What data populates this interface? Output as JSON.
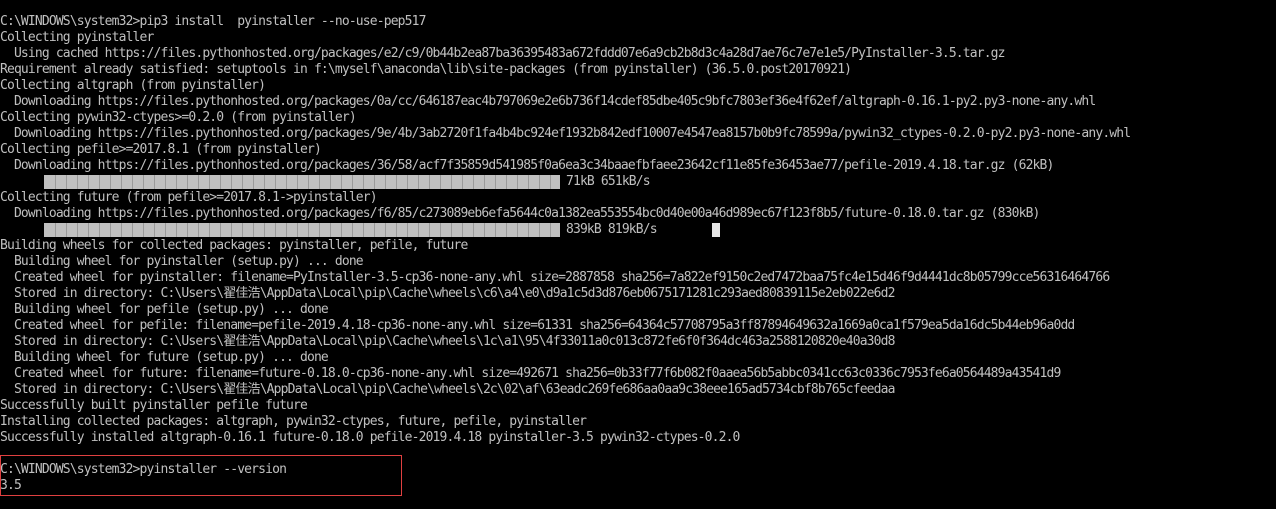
{
  "terminal": {
    "lines": [
      "C:\\WINDOWS\\system32>pip3 install  pyinstaller --no-use-pep517",
      "Collecting pyinstaller",
      "  Using cached https://files.pythonhosted.org/packages/e2/c9/0b44b2ea87ba36395483a672fddd07e6a9cb2b8d3c4a28d7ae76c7e7e1e5/PyInstaller-3.5.tar.gz",
      "Requirement already satisfied: setuptools in f:\\myself\\anaconda\\lib\\site-packages (from pyinstaller) (36.5.0.post20170921)",
      "Collecting altgraph (from pyinstaller)",
      "  Downloading https://files.pythonhosted.org/packages/0a/cc/646187eac4b797069e2e6b736f14cdef85dbe405c9bfc7803ef36e4f62ef/altgraph-0.16.1-py2.py3-none-any.whl",
      "Collecting pywin32-ctypes>=0.2.0 (from pyinstaller)",
      "  Downloading https://files.pythonhosted.org/packages/9e/4b/3ab2720f1fa4b4bc924ef1932b842edf10007e4547ea8157b0b9fc78599a/pywin32_ctypes-0.2.0-py2.py3-none-any.whl",
      "Collecting pefile>=2017.8.1 (from pyinstaller)",
      "  Downloading https://files.pythonhosted.org/packages/36/58/acf7f35859d541985f0a6ea3c34baaefbfaee23642cf11e85fe36453ae77/pefile-2019.4.18.tar.gz (62kB)",
      null,
      "Collecting future (from pefile>=2017.8.1->pyinstaller)",
      "  Downloading https://files.pythonhosted.org/packages/f6/85/c273089eb6efa5644c0a1382ea553554bc0d40e00a46d989ec67f123f8b5/future-0.18.0.tar.gz (830kB)",
      null,
      "Building wheels for collected packages: pyinstaller, pefile, future",
      "  Building wheel for pyinstaller (setup.py) ... done",
      "  Created wheel for pyinstaller: filename=PyInstaller-3.5-cp36-none-any.whl size=2887858 sha256=7a822ef9150c2ed7472baa75fc4e15d46f9d4441dc8b05799cce56316464766",
      "  Stored in directory: C:\\Users\\翟佳浩\\AppData\\Local\\pip\\Cache\\wheels\\c6\\a4\\e0\\d9a1c5d3d876eb0675171281c293aed80839115e2eb022e6d2",
      "  Building wheel for pefile (setup.py) ... done",
      "  Created wheel for pefile: filename=pefile-2019.4.18-cp36-none-any.whl size=61331 sha256=64364c57708795a3ff87894649632a1669a0ca1f579ea5da16dc5b44eb96a0dd",
      "  Stored in directory: C:\\Users\\翟佳浩\\AppData\\Local\\pip\\Cache\\wheels\\1c\\a1\\95\\4f33011a0c013c872fe6f0f364dc463a2588120820e40a30d8",
      "  Building wheel for future (setup.py) ... done",
      "  Created wheel for future: filename=future-0.18.0-cp36-none-any.whl size=492671 sha256=0b33f77f6b082f0aaea56b5abbc0341cc63c0336c7953fe6a0564489a43541d9",
      "  Stored in directory: C:\\Users\\翟佳浩\\AppData\\Local\\pip\\Cache\\wheels\\2c\\02\\af\\63eadc269fe686aa0aa9c38eee165ad5734cbf8b765cfeedaa",
      "Successfully built pyinstaller pefile future",
      "Installing collected packages: altgraph, pywin32-ctypes, future, pefile, pyinstaller",
      "Successfully installed altgraph-0.16.1 future-0.18.0 pefile-2019.4.18 pyinstaller-3.5 pywin32-ctypes-0.2.0",
      "",
      "C:\\WINDOWS\\system32>pyinstaller --version",
      "3.5"
    ],
    "progress": [
      {
        "stats": "71kB 651kB/s",
        "fraction": 1.0
      },
      {
        "stats": "839kB 819kB/s",
        "fraction": 1.0
      }
    ],
    "colors": {
      "background": "#000000",
      "foreground": "#c0c0c0",
      "highlight_border": "#e04040"
    }
  }
}
